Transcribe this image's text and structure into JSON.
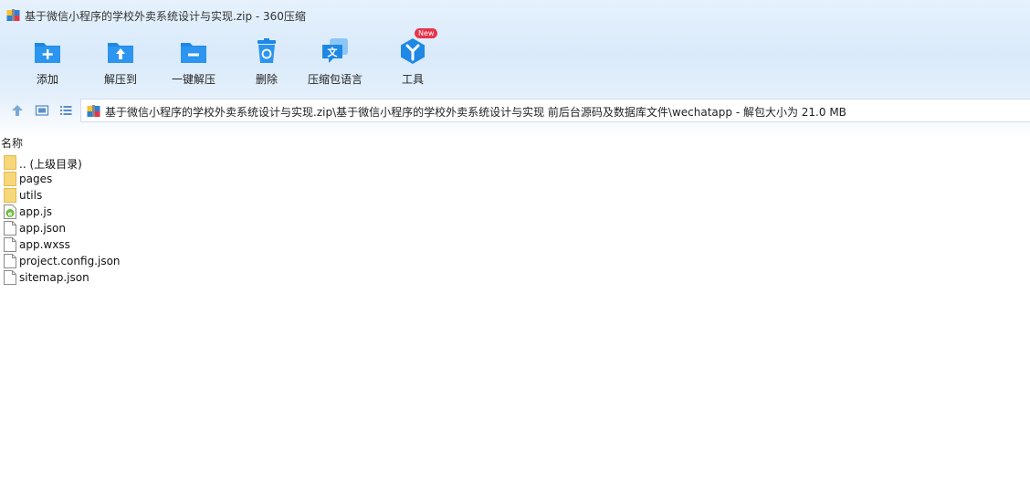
{
  "window": {
    "title": "基于微信小程序的学校外卖系统设计与实现.zip - 360压缩"
  },
  "toolbar": {
    "items": [
      {
        "label": "添加",
        "icon": "folder-add-icon"
      },
      {
        "label": "解压到",
        "icon": "folder-extract-icon"
      },
      {
        "label": "一键解压",
        "icon": "folder-one-key-icon"
      },
      {
        "label": "删除",
        "icon": "trash-icon"
      },
      {
        "label": "压缩包语言",
        "icon": "language-icon"
      },
      {
        "label": "工具",
        "icon": "tools-icon",
        "badge": "New"
      }
    ]
  },
  "address": {
    "path": "基于微信小程序的学校外卖系统设计与实现.zip\\基于微信小程序的学校外卖系统设计与实现 前后台源码及数据库文件\\wechatapp - 解包大小为 21.0 MB"
  },
  "list": {
    "header": "名称",
    "items": [
      {
        "name": ".. (上级目录)",
        "type": "folder"
      },
      {
        "name": "pages",
        "type": "folder"
      },
      {
        "name": "utils",
        "type": "folder"
      },
      {
        "name": "app.js",
        "type": "js"
      },
      {
        "name": "app.json",
        "type": "file"
      },
      {
        "name": "app.wxss",
        "type": "file"
      },
      {
        "name": "project.config.json",
        "type": "file"
      },
      {
        "name": "sitemap.json",
        "type": "file"
      }
    ]
  },
  "colors": {
    "accent": "#1e88e5",
    "badge": "#e8334a",
    "folder": "#f6d77a"
  }
}
